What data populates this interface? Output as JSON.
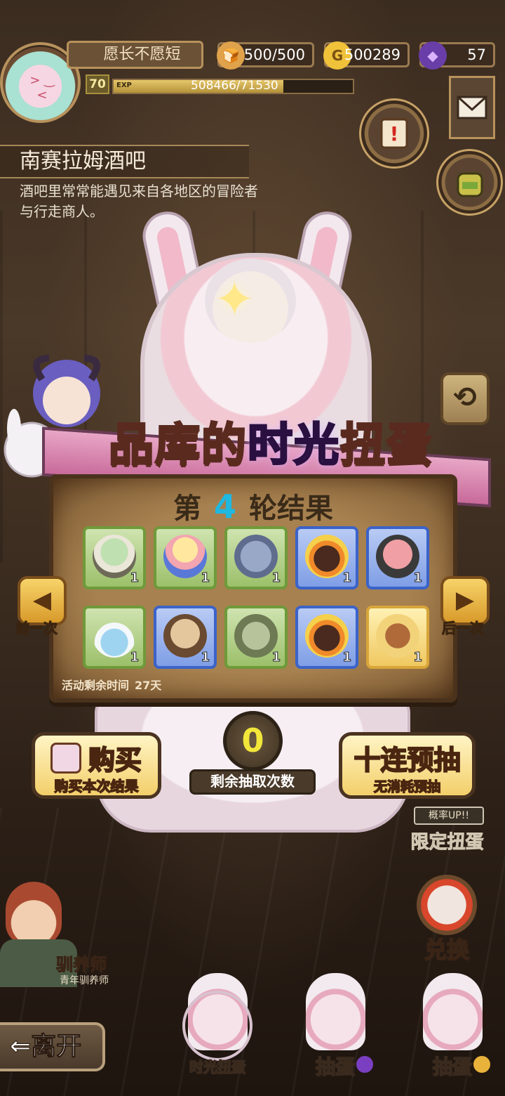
{
  "player": {
    "name": "愿长不愿短",
    "level": "70",
    "exp_label": "EXP",
    "exp_text": "508466/71530",
    "exp_progress": 0.71
  },
  "resources": {
    "stamina": "500/500",
    "gold": "500289",
    "gems": "57"
  },
  "location": {
    "title": "南赛拉姆酒吧",
    "description": "酒吧里常常能遇见来自各地区的冒险者与行走商人。"
  },
  "banner": {
    "title_part1": "品库的",
    "title_accent": "时光",
    "title_part2": "扭蛋"
  },
  "results": {
    "round_prefix": "第",
    "round_number": "4",
    "round_suffix": "轮结果",
    "items": [
      {
        "icon": "ufo-helmet-icon",
        "qty": "1",
        "rarity": "green"
      },
      {
        "icon": "sunrise-dome-icon",
        "qty": "1",
        "rarity": "green"
      },
      {
        "icon": "shell-helmet-icon",
        "qty": "1",
        "rarity": "green"
      },
      {
        "icon": "flame-crown-icon",
        "qty": "1",
        "rarity": "blue"
      },
      {
        "icon": "pig-hat-icon",
        "qty": "1",
        "rarity": "blue"
      },
      {
        "icon": "bottle-icon",
        "qty": "1",
        "rarity": "green"
      },
      {
        "icon": "fur-hat-icon",
        "qty": "1",
        "rarity": "blue"
      },
      {
        "icon": "leaf-cap-icon",
        "qty": "1",
        "rarity": "green"
      },
      {
        "icon": "flame-crown-icon",
        "qty": "1",
        "rarity": "blue"
      },
      {
        "icon": "lyre-icon",
        "qty": "1",
        "rarity": "gold"
      }
    ],
    "event_time_label": "活动剩余时间",
    "event_time_value": "27天"
  },
  "nav": {
    "prev_label": "前一次",
    "next_label": "后一次"
  },
  "actions": {
    "buy_main": "购买",
    "buy_sub": "购买本次结果",
    "remaining_count": "0",
    "remaining_label": "剩余抽取次数",
    "ten_main": "十连预抽",
    "ten_sub_highlight": "无消耗",
    "ten_sub_rest": "预抽",
    "limited_up": "概率UP!!",
    "limited_label": "限定扭蛋",
    "exchange_label": "兑换"
  },
  "npc": {
    "title": "驯养师",
    "subtitle": "青年驯养师"
  },
  "bottom": {
    "leave_label": "离开",
    "tabs": [
      {
        "label": "时光扭蛋"
      },
      {
        "label": "抽蛋"
      },
      {
        "label": "抽蛋"
      }
    ]
  },
  "colors": {
    "accent_purple": "#b36cff",
    "round_number": "#1fb8e0",
    "count_yellow": "#f2e63a"
  }
}
